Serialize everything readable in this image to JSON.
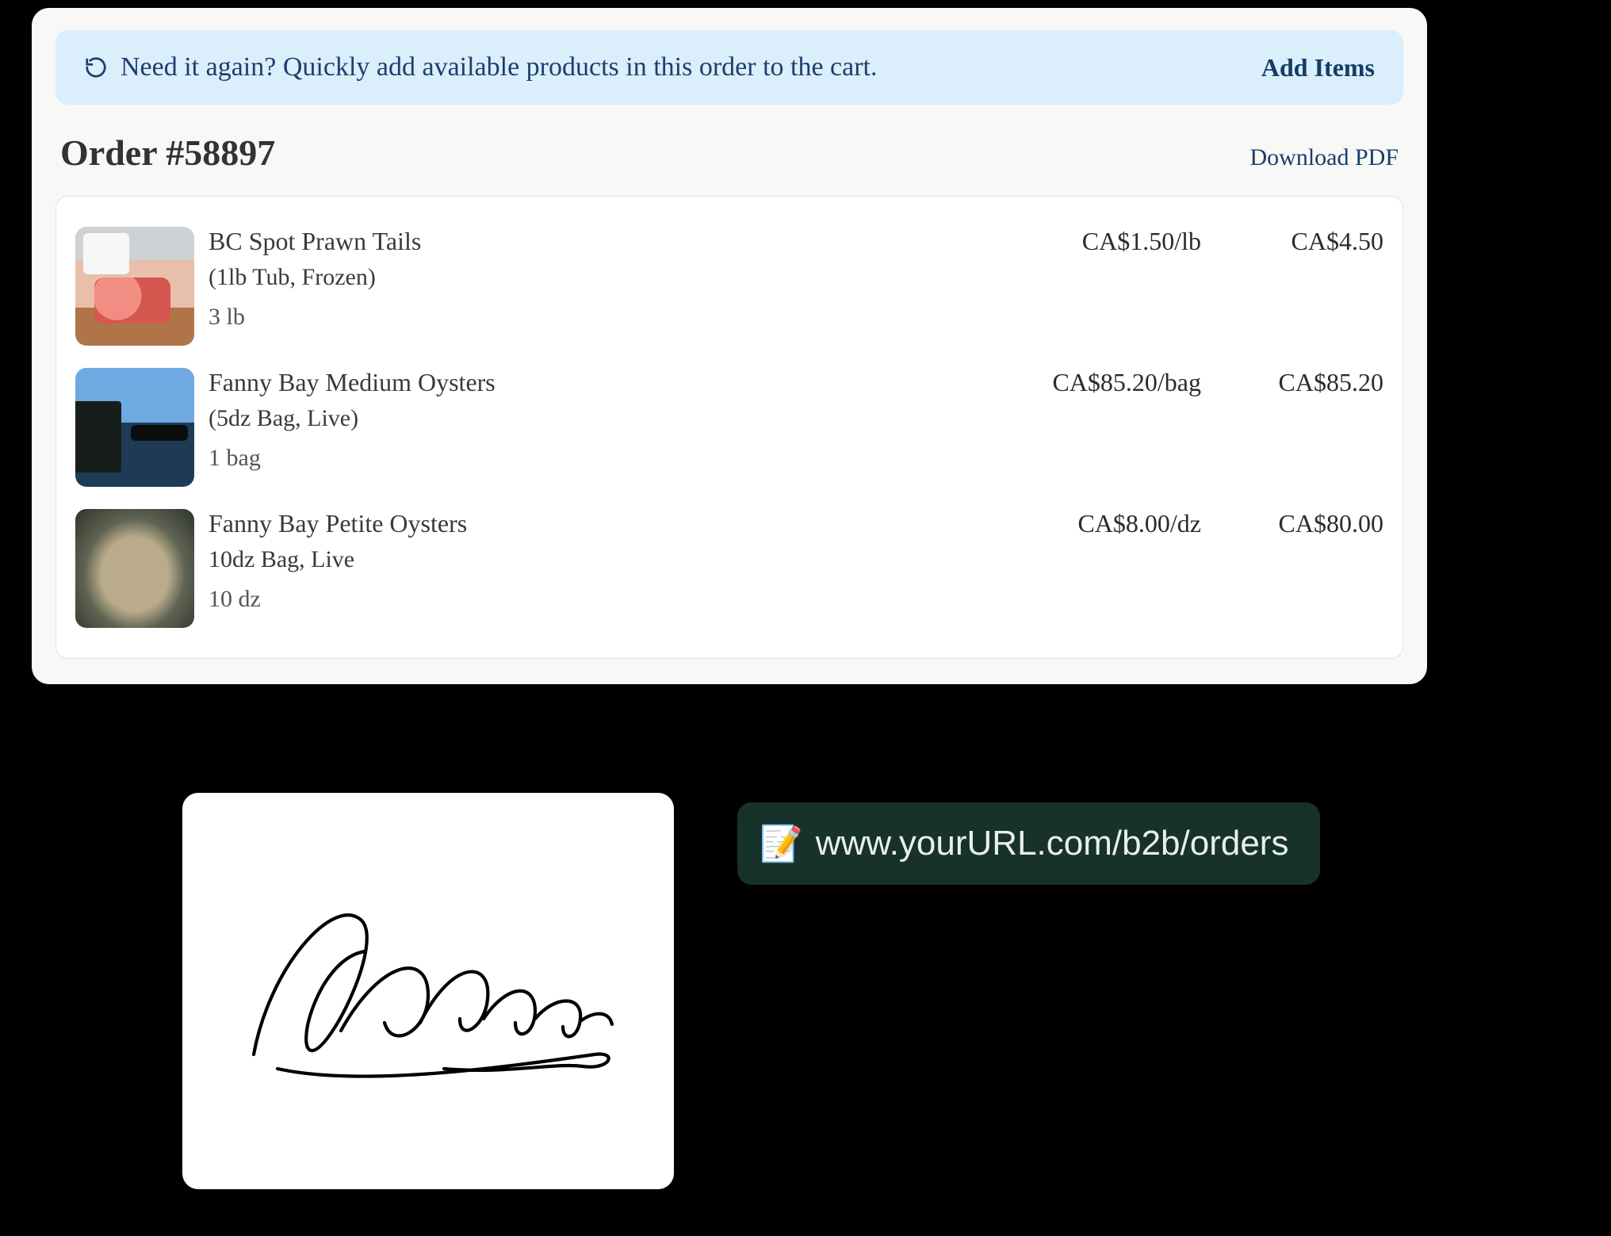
{
  "banner": {
    "text": "Need it again? Quickly add available products in this order to the cart.",
    "action_label": "Add Items"
  },
  "order": {
    "title": "Order #58897",
    "download_label": "Download PDF"
  },
  "lines": [
    {
      "name": "BC Spot Prawn Tails",
      "pack": "(1lb Tub, Frozen)",
      "qty": "3 lb",
      "unit_price": "CA$1.50/lb",
      "line_total": "CA$4.50"
    },
    {
      "name": "Fanny Bay Medium Oysters",
      "pack": "(5dz Bag, Live)",
      "qty": "1 bag",
      "unit_price": "CA$85.20/bag",
      "line_total": "CA$85.20"
    },
    {
      "name": "Fanny Bay Petite Oysters",
      "pack": "10dz Bag, Live",
      "qty": "10 dz",
      "unit_price": "CA$8.00/dz",
      "line_total": "CA$80.00"
    }
  ],
  "url_pill": {
    "icon": "📝",
    "text": "www.yourURL.com/b2b/orders"
  }
}
